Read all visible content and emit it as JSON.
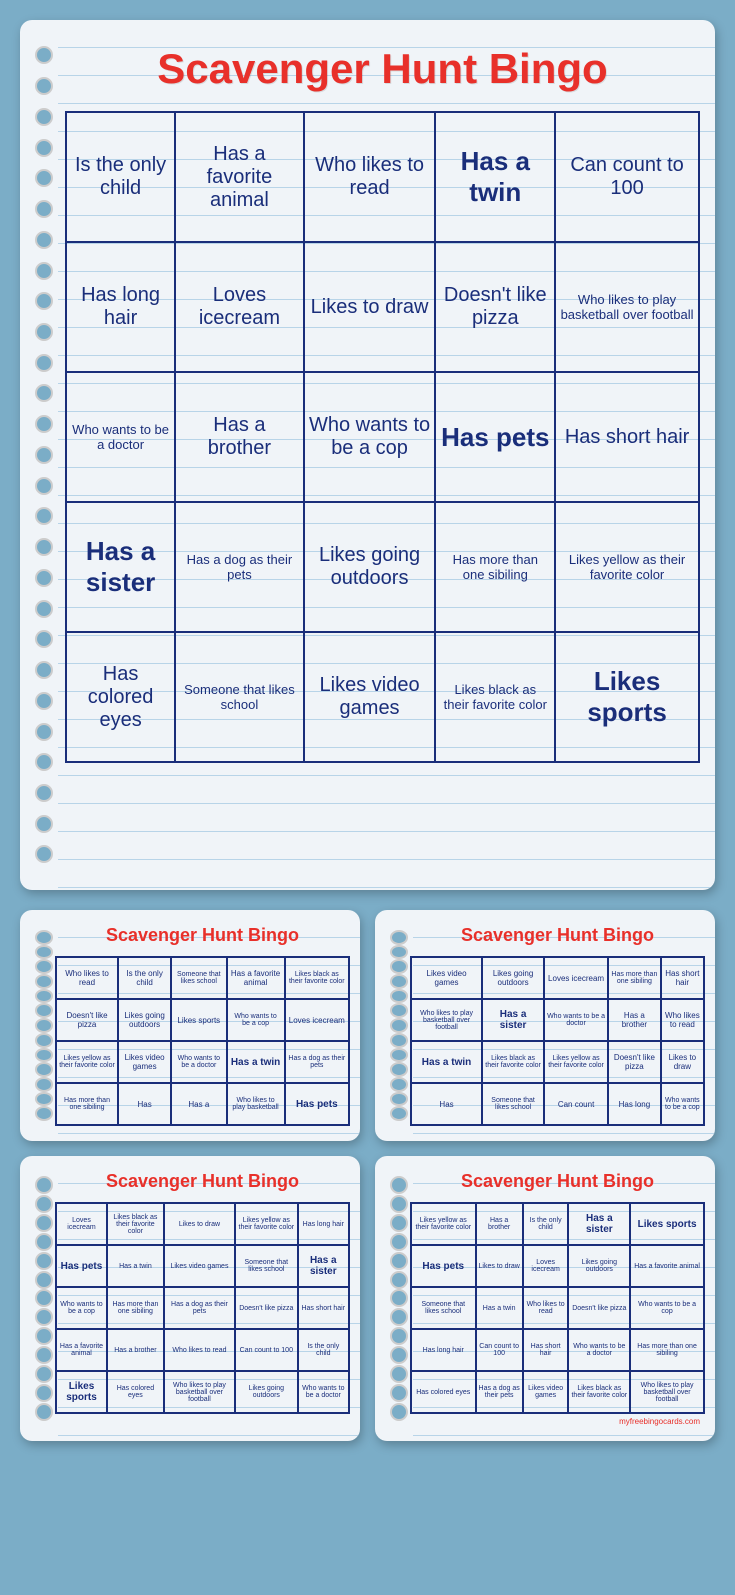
{
  "main_card": {
    "title": "Scavenger Hunt Bingo",
    "grid": [
      [
        {
          "text": "Is the only child",
          "size": "medium"
        },
        {
          "text": "Has a favorite animal",
          "size": "medium"
        },
        {
          "text": "Who likes to read",
          "size": "medium"
        },
        {
          "text": "Has a twin",
          "size": "large"
        },
        {
          "text": "Can count to 100",
          "size": "medium"
        }
      ],
      [
        {
          "text": "Has long hair",
          "size": "medium"
        },
        {
          "text": "Loves icecream",
          "size": "medium"
        },
        {
          "text": "Likes to draw",
          "size": "medium"
        },
        {
          "text": "Doesn't like pizza",
          "size": "medium"
        },
        {
          "text": "Who likes to play basketball over football",
          "size": "small"
        }
      ],
      [
        {
          "text": "Who wants to be a doctor",
          "size": "small"
        },
        {
          "text": "Has a brother",
          "size": "medium"
        },
        {
          "text": "Who wants to be a cop",
          "size": "medium"
        },
        {
          "text": "Has pets",
          "size": "large"
        },
        {
          "text": "Has short hair",
          "size": "medium"
        }
      ],
      [
        {
          "text": "Has a sister",
          "size": "large"
        },
        {
          "text": "Has a dog as their pets",
          "size": "small"
        },
        {
          "text": "Likes going outdoors",
          "size": "medium"
        },
        {
          "text": "Has more than one sibiling",
          "size": "small"
        },
        {
          "text": "Likes yellow as their favorite color",
          "size": "small"
        }
      ],
      [
        {
          "text": "Has colored eyes",
          "size": "medium"
        },
        {
          "text": "Someone that likes school",
          "size": "small"
        },
        {
          "text": "Likes video games",
          "size": "medium"
        },
        {
          "text": "Likes black as their favorite color",
          "size": "small"
        },
        {
          "text": "Likes sports",
          "size": "large"
        }
      ]
    ]
  },
  "card2": {
    "title": "Scavenger Hunt Bingo",
    "grid": [
      [
        {
          "text": "Who likes to read",
          "size": "medium"
        },
        {
          "text": "Is the only child",
          "size": "medium"
        },
        {
          "text": "Someone that likes school",
          "size": "small"
        },
        {
          "text": "Has a favorite animal",
          "size": "medium"
        },
        {
          "text": "Likes black as their favorite color",
          "size": "small"
        }
      ],
      [
        {
          "text": "Doesn't like pizza",
          "size": "medium"
        },
        {
          "text": "Likes going outdoors",
          "size": "medium"
        },
        {
          "text": "Likes sports",
          "size": "medium"
        },
        {
          "text": "Who wants to be a cop",
          "size": "small"
        },
        {
          "text": "Loves icecream",
          "size": "medium"
        }
      ],
      [
        {
          "text": "Likes yellow as their favorite color",
          "size": "small"
        },
        {
          "text": "Likes video games",
          "size": "medium"
        },
        {
          "text": "Who wants to be a doctor",
          "size": "small"
        },
        {
          "text": "Has a twin",
          "size": "large"
        },
        {
          "text": "Has a dog as their pets",
          "size": "small"
        }
      ],
      [
        {
          "text": "Has more than one sibiling",
          "size": "small"
        },
        {
          "text": "Has",
          "size": "medium"
        },
        {
          "text": "Has a",
          "size": "medium"
        },
        {
          "text": "Who likes to play basketball",
          "size": "small"
        },
        {
          "text": "Has pets",
          "size": "large"
        }
      ]
    ]
  },
  "card3": {
    "title": "Scavenger Hunt Bingo",
    "grid": [
      [
        {
          "text": "Likes video games",
          "size": "medium"
        },
        {
          "text": "Likes going outdoors",
          "size": "medium"
        },
        {
          "text": "Loves icecream",
          "size": "medium"
        },
        {
          "text": "Has more than one sibiling",
          "size": "small"
        },
        {
          "text": "Has short hair",
          "size": "medium"
        }
      ],
      [
        {
          "text": "Who likes to play basketball over football",
          "size": "small"
        },
        {
          "text": "Has a sister",
          "size": "large"
        },
        {
          "text": "Who wants to be a doctor",
          "size": "small"
        },
        {
          "text": "Has a brother",
          "size": "medium"
        },
        {
          "text": "Who likes to read",
          "size": "medium"
        }
      ],
      [
        {
          "text": "Has a twin",
          "size": "large"
        },
        {
          "text": "Likes black as their favorite color",
          "size": "small"
        },
        {
          "text": "Likes yellow as their favorite color",
          "size": "small"
        },
        {
          "text": "Doesn't like pizza",
          "size": "medium"
        },
        {
          "text": "Likes to draw",
          "size": "medium"
        }
      ],
      [
        {
          "text": "Has",
          "size": "medium"
        },
        {
          "text": "Someone that likes school",
          "size": "small"
        },
        {
          "text": "Can count",
          "size": "medium"
        },
        {
          "text": "Has long",
          "size": "medium"
        },
        {
          "text": "Who wants to be a cop",
          "size": "small"
        }
      ]
    ]
  },
  "card4": {
    "title": "Scavenger Hunt Bingo",
    "grid": [
      [
        {
          "text": "Loves icecream",
          "size": "medium"
        },
        {
          "text": "Likes black as their favorite color",
          "size": "small"
        },
        {
          "text": "Likes to draw",
          "size": "medium"
        },
        {
          "text": "Likes yellow as their favorite color",
          "size": "small"
        },
        {
          "text": "Has long hair",
          "size": "medium"
        }
      ],
      [
        {
          "text": "Has pets",
          "size": "large"
        },
        {
          "text": "Has a twin",
          "size": "medium"
        },
        {
          "text": "Likes video games",
          "size": "medium"
        },
        {
          "text": "Someone that likes school",
          "size": "small"
        },
        {
          "text": "Has a sister",
          "size": "large"
        }
      ],
      [
        {
          "text": "Who wants to be a cop",
          "size": "small"
        },
        {
          "text": "Has more than one sibiling",
          "size": "small"
        },
        {
          "text": "Has a dog as their pets",
          "size": "small"
        },
        {
          "text": "Doesn't like pizza",
          "size": "medium"
        },
        {
          "text": "Has short hair",
          "size": "medium"
        }
      ],
      [
        {
          "text": "Has a favorite animal",
          "size": "medium"
        },
        {
          "text": "Has a brother",
          "size": "medium"
        },
        {
          "text": "Who likes to read",
          "size": "medium"
        },
        {
          "text": "Can count to 100",
          "size": "medium"
        },
        {
          "text": "Is the only child",
          "size": "medium"
        }
      ],
      [
        {
          "text": "Likes sports",
          "size": "large"
        },
        {
          "text": "Has colored eyes",
          "size": "medium"
        },
        {
          "text": "Who likes to play basketball over football",
          "size": "small"
        },
        {
          "text": "Likes going outdoors",
          "size": "medium"
        },
        {
          "text": "Who wants to be a doctor",
          "size": "small"
        }
      ]
    ]
  },
  "card5": {
    "title": "Scavenger Hunt Bingo",
    "grid": [
      [
        {
          "text": "Likes yellow as their favorite color",
          "size": "small"
        },
        {
          "text": "Has a brother",
          "size": "medium"
        },
        {
          "text": "Is the only child",
          "size": "medium"
        },
        {
          "text": "Has a sister",
          "size": "large"
        },
        {
          "text": "Likes sports",
          "size": "large"
        }
      ],
      [
        {
          "text": "Has pets",
          "size": "large"
        },
        {
          "text": "Likes to draw",
          "size": "medium"
        },
        {
          "text": "Loves icecream",
          "size": "medium"
        },
        {
          "text": "Likes going outdoors",
          "size": "medium"
        },
        {
          "text": "Has a favorite animal",
          "size": "medium"
        }
      ],
      [
        {
          "text": "Someone that likes school",
          "size": "small"
        },
        {
          "text": "Has a twin",
          "size": "medium"
        },
        {
          "text": "Who likes to read",
          "size": "medium"
        },
        {
          "text": "Doesn't like pizza",
          "size": "medium"
        },
        {
          "text": "Who wants to be a cop",
          "size": "small"
        }
      ],
      [
        {
          "text": "Has long hair",
          "size": "medium"
        },
        {
          "text": "Can count to 100",
          "size": "medium"
        },
        {
          "text": "Has short hair",
          "size": "medium"
        },
        {
          "text": "Who wants to be a doctor",
          "size": "small"
        },
        {
          "text": "Has more than one sibiling",
          "size": "small"
        }
      ],
      [
        {
          "text": "Has colored eyes",
          "size": "medium"
        },
        {
          "text": "Has a dog as their pets",
          "size": "small"
        },
        {
          "text": "Likes video games",
          "size": "medium"
        },
        {
          "text": "Likes black as their favorite color",
          "size": "small"
        },
        {
          "text": "Who likes to play basketball over football",
          "size": "small"
        }
      ]
    ]
  },
  "watermark": "myfreebingocards.com"
}
